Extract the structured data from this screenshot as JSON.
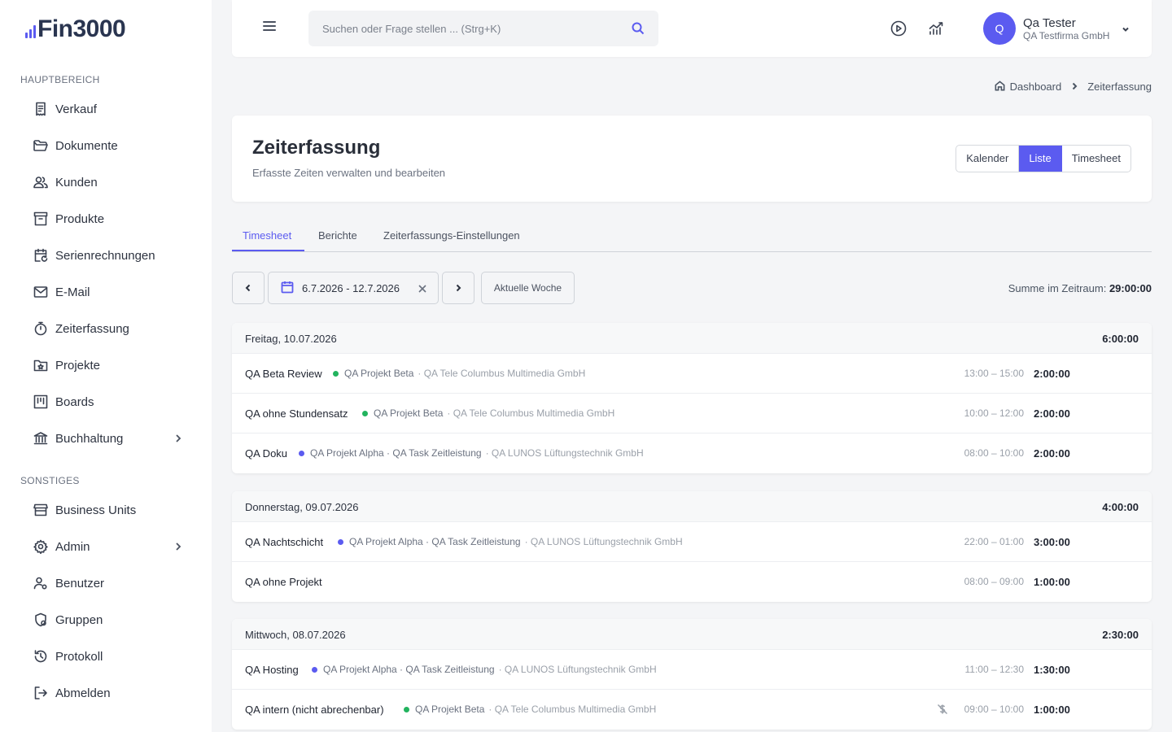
{
  "brand": {
    "logo_text": "Fin3000",
    "accent": "#5b5bf0"
  },
  "sidebar": {
    "section_main": "HAUPTBEREICH",
    "section_other": "SONSTIGES",
    "main_items": [
      {
        "label": "Verkauf",
        "icon": "receipt-icon"
      },
      {
        "label": "Dokumente",
        "icon": "folder-open-icon"
      },
      {
        "label": "Kunden",
        "icon": "users-icon"
      },
      {
        "label": "Produkte",
        "icon": "archive-box-icon"
      },
      {
        "label": "Serienrechnungen",
        "icon": "calendar-repeat-icon"
      },
      {
        "label": "E-Mail",
        "icon": "mail-icon"
      },
      {
        "label": "Zeiterfassung",
        "icon": "stopwatch-icon"
      },
      {
        "label": "Projekte",
        "icon": "folder-star-icon"
      },
      {
        "label": "Boards",
        "icon": "kanban-icon"
      },
      {
        "label": "Buchhaltung",
        "icon": "bank-icon"
      }
    ],
    "other_items": [
      {
        "label": "Business Units",
        "icon": "store-icon"
      },
      {
        "label": "Admin",
        "icon": "gear-icon"
      },
      {
        "label": "Benutzer",
        "icon": "user-cog-icon"
      },
      {
        "label": "Gruppen",
        "icon": "shield-user-icon"
      },
      {
        "label": "Protokoll",
        "icon": "history-icon"
      },
      {
        "label": "Abmelden",
        "icon": "logout-icon"
      }
    ]
  },
  "topbar": {
    "search_placeholder": "Suchen oder Frage stellen ... (Strg+K)",
    "user_initial": "Q",
    "user_name": "Qa Tester",
    "user_company": "QA Testfirma GmbH"
  },
  "breadcrumb": {
    "home": "Dashboard",
    "current": "Zeiterfassung"
  },
  "header": {
    "title": "Zeiterfassung",
    "subtitle": "Erfasste Zeiten verwalten und bearbeiten",
    "views": [
      "Kalender",
      "Liste",
      "Timesheet"
    ],
    "active_view": "Liste"
  },
  "tabs": [
    {
      "label": "Timesheet",
      "active": true
    },
    {
      "label": "Berichte",
      "active": false
    },
    {
      "label": "Zeiterfassungs-Einstellungen",
      "active": false
    }
  ],
  "controls": {
    "date_range": "6.7.2026 - 12.7.2026",
    "current_week": "Aktuelle Woche",
    "sum_label": "Summe im Zeitraum:",
    "sum_value": "29:00:00"
  },
  "days": [
    {
      "label": "Freitag, 10.07.2026",
      "total": "6:00:00",
      "entries": [
        {
          "title": "QA Beta Review",
          "dot": "#22b35e",
          "project": "QA Projekt Beta",
          "customer": "· QA Tele Columbus Multimedia GmbH",
          "time": "13:00 – 15:00",
          "duration": "2:00:00",
          "non_billable": false
        },
        {
          "title": "QA ohne Stundensatz",
          "dot": "#22b35e",
          "project": "QA Projekt Beta",
          "customer": "· QA Tele Columbus Multimedia GmbH",
          "time": "10:00 – 12:00",
          "duration": "2:00:00",
          "non_billable": false
        },
        {
          "title": "QA Doku",
          "dot": "#5b5bf0",
          "project": "QA Projekt Alpha · QA Task Zeitleistung",
          "customer": "· QA LUNOS Lüftungstechnik GmbH",
          "time": "08:00 – 10:00",
          "duration": "2:00:00",
          "non_billable": false
        }
      ]
    },
    {
      "label": "Donnerstag, 09.07.2026",
      "total": "4:00:00",
      "entries": [
        {
          "title": "QA Nachtschicht",
          "dot": "#5b5bf0",
          "project": "QA Projekt Alpha · QA Task Zeitleistung",
          "customer": "· QA LUNOS Lüftungstechnik GmbH",
          "time": "22:00 – 01:00",
          "duration": "3:00:00",
          "non_billable": false
        },
        {
          "title": "QA ohne Projekt",
          "dot": "",
          "project": "",
          "customer": "",
          "time": "08:00 – 09:00",
          "duration": "1:00:00",
          "non_billable": false
        }
      ]
    },
    {
      "label": "Mittwoch, 08.07.2026",
      "total": "2:30:00",
      "entries": [
        {
          "title": "QA Hosting",
          "dot": "#5b5bf0",
          "project": "QA Projekt Alpha · QA Task Zeitleistung",
          "customer": "· QA LUNOS Lüftungstechnik GmbH",
          "time": "11:00 – 12:30",
          "duration": "1:30:00",
          "non_billable": false
        },
        {
          "title": "QA intern (nicht abrechenbar)",
          "dot": "#22b35e",
          "project": "QA Projekt Beta",
          "customer": "· QA Tele Columbus Multimedia GmbH",
          "time": "09:00 – 10:00",
          "duration": "1:00:00",
          "non_billable": true
        }
      ]
    }
  ]
}
